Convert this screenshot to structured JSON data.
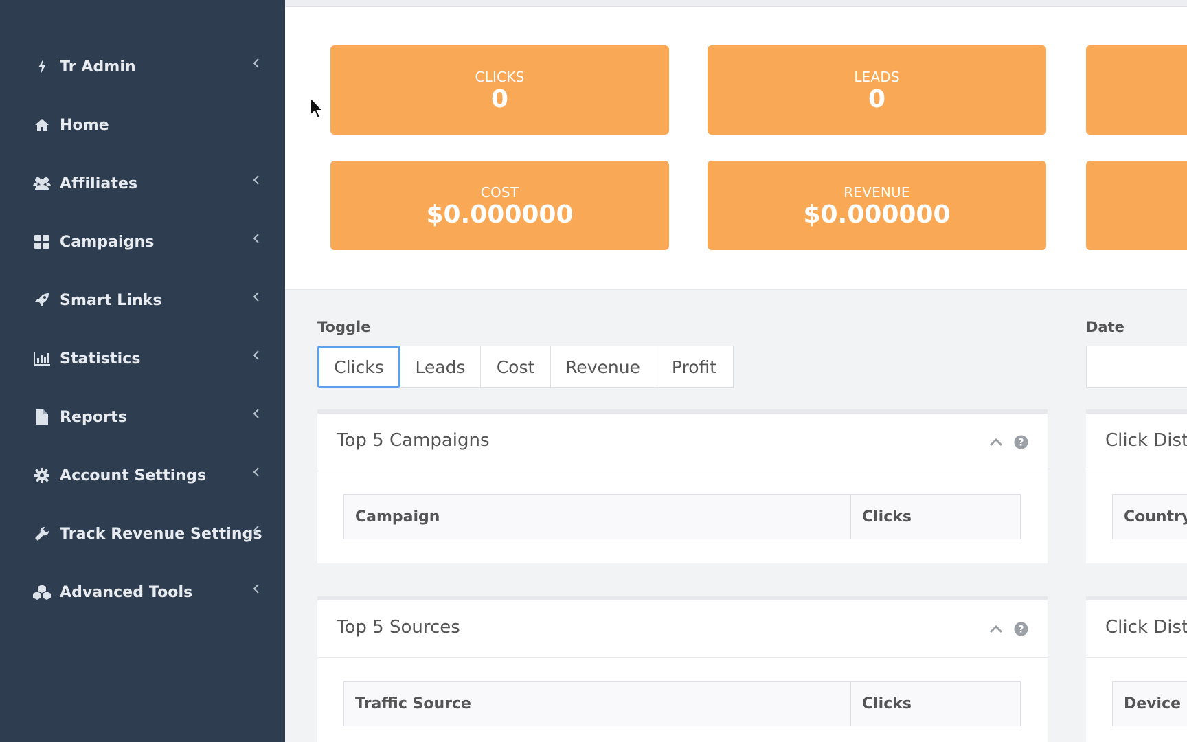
{
  "sidebar": {
    "items": [
      {
        "label": "Tr Admin",
        "icon": "bolt-icon",
        "has_chevron": true
      },
      {
        "label": "Home",
        "icon": "home-icon",
        "has_chevron": false
      },
      {
        "label": "Affiliates",
        "icon": "users-icon",
        "has_chevron": true
      },
      {
        "label": "Campaigns",
        "icon": "grid-icon",
        "has_chevron": true
      },
      {
        "label": "Smart Links",
        "icon": "rocket-icon",
        "has_chevron": true
      },
      {
        "label": "Statistics",
        "icon": "bar-chart-icon",
        "has_chevron": true
      },
      {
        "label": "Reports",
        "icon": "file-icon",
        "has_chevron": true
      },
      {
        "label": "Account Settings",
        "icon": "gear-icon",
        "has_chevron": true
      },
      {
        "label": "Track Revenue Settings",
        "icon": "wrench-icon",
        "has_chevron": true
      },
      {
        "label": "Advanced Tools",
        "icon": "cubes-icon",
        "has_chevron": true
      }
    ]
  },
  "stats": {
    "clicks": {
      "label": "CLICKS",
      "value": "0"
    },
    "leads": {
      "label": "LEADS",
      "value": "0"
    },
    "cost": {
      "label": "COST",
      "value": "$0.000000"
    },
    "revenue": {
      "label": "REVENUE",
      "value": "$0.000000"
    }
  },
  "toggle": {
    "label": "Toggle",
    "options": [
      "Clicks",
      "Leads",
      "Cost",
      "Revenue",
      "Profit"
    ],
    "selected": "Clicks"
  },
  "date": {
    "label": "Date",
    "value": ""
  },
  "panels": {
    "top_campaigns": {
      "title": "Top 5 Campaigns",
      "columns": [
        "Campaign",
        "Clicks"
      ]
    },
    "top_sources": {
      "title": "Top 5 Sources",
      "columns": [
        "Traffic Source",
        "Clicks"
      ]
    },
    "click_dist_country": {
      "title": "Click Distribution",
      "columns": [
        "Country"
      ]
    },
    "click_dist_device": {
      "title": "Click Distribution",
      "columns": [
        "Device"
      ]
    }
  },
  "colors": {
    "sidebar_bg": "#2e3e50",
    "stat_card": "#f9a956",
    "toggle_active_border": "#5fa0ea",
    "page_bg": "#f2f3f5"
  }
}
